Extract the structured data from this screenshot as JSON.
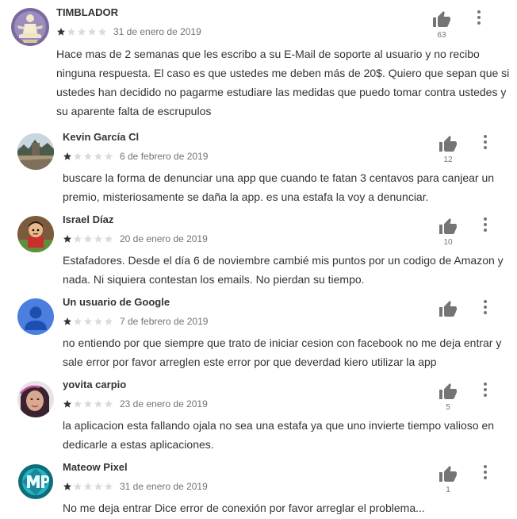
{
  "reviews": [
    {
      "author": "TIMBLADOR",
      "rating": 1,
      "date": "31 de enero de 2019",
      "text": [
        "Hace mas de 2 semanas que les escribo a su E-Mail de soporte al usuario y no recibo",
        "ninguna respuesta. El caso es que ustedes me deben más de 20$. Quiero que sepan que si",
        "ustedes han decidido no pagarme estudiare las medidas que puedo tomar contra ustedes y",
        "su aparente falta de escrupulos"
      ],
      "likes": "63",
      "avatar": "meditating-figure-avatar"
    },
    {
      "author": "Kevin García Cl",
      "rating": 1,
      "date": "6 de febrero de 2019",
      "text": [
        "buscare la forma de denunciar una app que cuando te fatan 3 centavos para canjear un",
        "premio, misteriosamente se daña la app. es una estafa la voy a denunciar."
      ],
      "likes": "12",
      "avatar": "landscape-photo-avatar"
    },
    {
      "author": "Israel Díaz",
      "rating": 1,
      "date": "20 de enero de 2019",
      "text": [
        "Estafadores. Desde el día 6 de noviembre cambié mis puntos por un codigo de Amazon y",
        "nada. Ni siquiera contestan los emails. No pierdan su tiempo."
      ],
      "likes": "10",
      "avatar": "cartoon-character-avatar"
    },
    {
      "author": "Un usuario de Google",
      "rating": 1,
      "date": "7 de febrero de 2019",
      "text": [
        "no entiendo por que siempre que trato de iniciar cesion con facebook no me deja entrar y",
        "sale error por favor arreglen este error por que deverdad kiero utilizar la app"
      ],
      "likes": "",
      "avatar": "default-person-avatar"
    },
    {
      "author": "yovita carpio",
      "rating": 1,
      "date": "23 de enero de 2019",
      "text": [
        "la aplicacion esta fallando ojala no sea una estafa ya que uno invierte tiempo valioso en",
        "dedicarle a estas aplicaciones."
      ],
      "likes": "5",
      "avatar": "selfie-photo-avatar"
    },
    {
      "author": "Mateow Pixel",
      "rating": 1,
      "date": "31 de enero de 2019",
      "text": [
        "No me deja entrar Dice error de conexión por favor arreglar el problema..."
      ],
      "likes": "1",
      "avatar": "mp-logo-avatar"
    }
  ],
  "colors": {
    "star_filled": "#333333",
    "star_empty": "#dadada",
    "text": "#333333",
    "meta": "#737373",
    "icon": "#757575"
  }
}
